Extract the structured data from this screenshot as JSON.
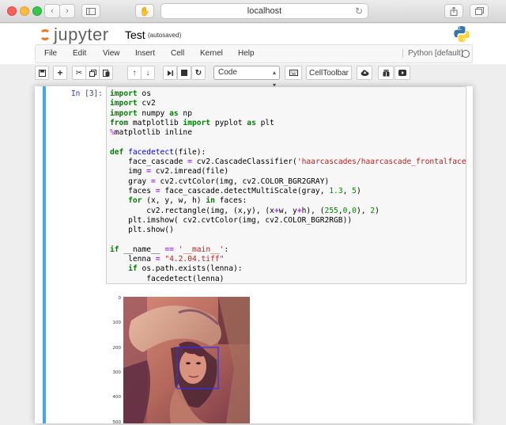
{
  "browser": {
    "url": "localhost",
    "back_icon": "chevron-left-icon",
    "forward_icon": "chevron-right-icon"
  },
  "notebook": {
    "logo_text": "jupyter",
    "name": "Test",
    "save_status": "(autosaved)"
  },
  "menu": {
    "items": [
      "File",
      "Edit",
      "View",
      "Insert",
      "Cell",
      "Kernel",
      "Help"
    ],
    "kernel_name": "Python [default]"
  },
  "toolbar": {
    "cell_type": "Code",
    "celltoolbar_label": "CellToolbar"
  },
  "cell": {
    "prompt": "In [3]:"
  },
  "plot": {
    "yticks": [
      "0",
      "100",
      "200",
      "300",
      "400",
      "500"
    ]
  },
  "colors": {
    "accent": "#42a5f5",
    "jupyter_orange": "#f37626"
  }
}
